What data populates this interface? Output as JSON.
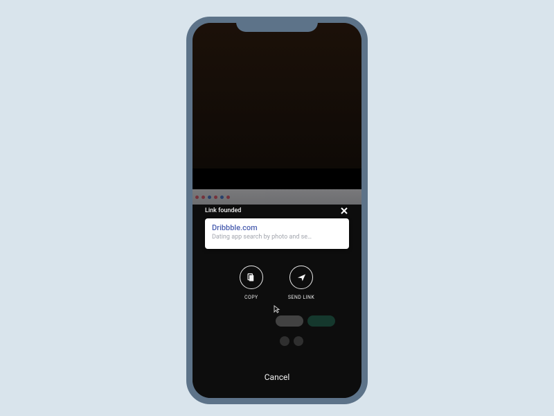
{
  "sheet": {
    "toast": "Link founded",
    "card": {
      "title": "Dribbble.com",
      "subtitle": "Dating app search by photo and se…"
    },
    "actions": {
      "copy": "COPY",
      "send": "SEND LINK"
    },
    "cancel": "Cancel"
  }
}
